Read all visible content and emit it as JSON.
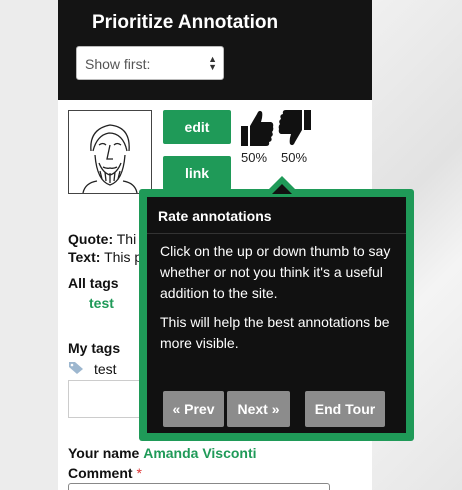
{
  "panel": {
    "title": "Prioritize Annotation",
    "sort_select": {
      "value": "Show first:"
    }
  },
  "annotation": {
    "edit_label": "edit",
    "link_label": "link",
    "thumb_up_icon": "thumbs-up-icon",
    "thumb_down_icon": "thumbs-down-icon",
    "up_percent": "50%",
    "down_percent": "50%",
    "quote_label": "Quote:",
    "quote_value": "Thi",
    "text_label": "Text:",
    "text_value": "This p",
    "all_tags_label": "All tags",
    "all_tags": [
      "test"
    ],
    "my_tags_label": "My tags",
    "my_tags": [
      "test"
    ],
    "your_name_label": "Your name",
    "your_name_value": "Amanda Visconti",
    "comment_label": "Comment",
    "required_mark": "*"
  },
  "tour": {
    "title": "Rate annotations",
    "paragraph1": "Click on the up or down thumb to say whether or not you think it's a useful addition to the site.",
    "paragraph2": "This will help the best annotations be more visible.",
    "prev_label": "« Prev",
    "next_label": "Next »",
    "end_label": "End Tour"
  },
  "colors": {
    "accent_green": "#1f9a58",
    "header_black": "#141414",
    "tour_button_gray": "#8c8c8c"
  }
}
